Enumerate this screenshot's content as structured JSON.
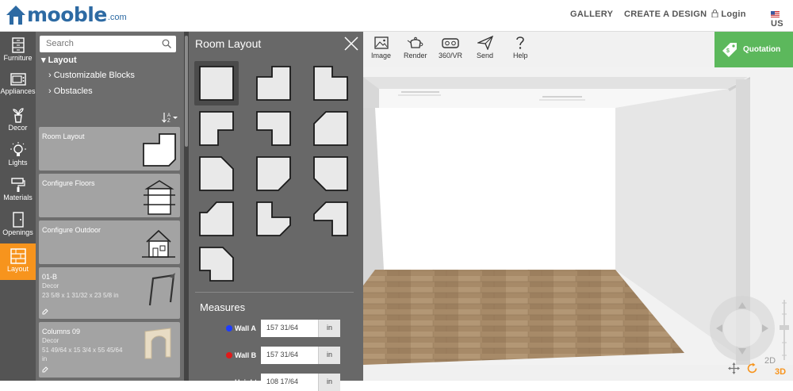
{
  "header": {
    "logo": "mooble",
    "logo_suffix": ".com",
    "nav": [
      "GALLERY",
      "CREATE A DESIGN"
    ],
    "login": "Login",
    "region": "US"
  },
  "iconbar": {
    "items": [
      {
        "label": "Furniture",
        "icon": "furniture-icon"
      },
      {
        "label": "Appliances",
        "icon": "appliances-icon"
      },
      {
        "label": "Decor",
        "icon": "decor-icon"
      },
      {
        "label": "Lights",
        "icon": "lights-icon"
      },
      {
        "label": "Materials",
        "icon": "materials-icon"
      },
      {
        "label": "Openings",
        "icon": "openings-icon"
      },
      {
        "label": "Layout",
        "icon": "layout-icon",
        "active": true
      }
    ],
    "active_color": "#f7941d"
  },
  "catalog": {
    "search_placeholder": "Search",
    "tree": {
      "root": "Layout",
      "children": [
        "Customizable Blocks",
        "Obstacles"
      ]
    },
    "cards": [
      {
        "title": "Room Layout"
      },
      {
        "title": "Configure Floors"
      },
      {
        "title": "Configure Outdoor"
      },
      {
        "title": "01-B",
        "category": "Decor",
        "dims": "23 5/8 x 1 31/32 x 23 5/8 in"
      },
      {
        "title": "Columns 09",
        "category": "Decor",
        "dims": "51 49/64 x 15 3/4 x 55 45/64",
        "dims2": "in"
      }
    ]
  },
  "room_layout": {
    "title": "Room Layout",
    "shape_count": 13,
    "selected_shape": 1,
    "measures_title": "Measures",
    "walls": [
      {
        "label": "Wall A",
        "value": "157 31/64",
        "unit": "in",
        "color": "#1e3cff"
      },
      {
        "label": "Wall B",
        "value": "157 31/64",
        "unit": "in",
        "color": "#e01a1a"
      },
      {
        "label": "Height",
        "value": "108 17/64",
        "unit": "in"
      }
    ]
  },
  "toolbar": {
    "items": [
      {
        "label": "Image",
        "icon": "image-icon"
      },
      {
        "label": "Render",
        "icon": "teapot-icon"
      },
      {
        "label": "360/VR",
        "icon": "vr-icon"
      },
      {
        "label": "Send",
        "icon": "send-icon"
      },
      {
        "label": "Help",
        "icon": "help-icon"
      }
    ],
    "quotation": "Quotation",
    "quotation_color": "#5cb85c"
  },
  "view_controls": {
    "mode_2d": "2D",
    "mode_3d": "3D",
    "accent": "#f7941d"
  }
}
